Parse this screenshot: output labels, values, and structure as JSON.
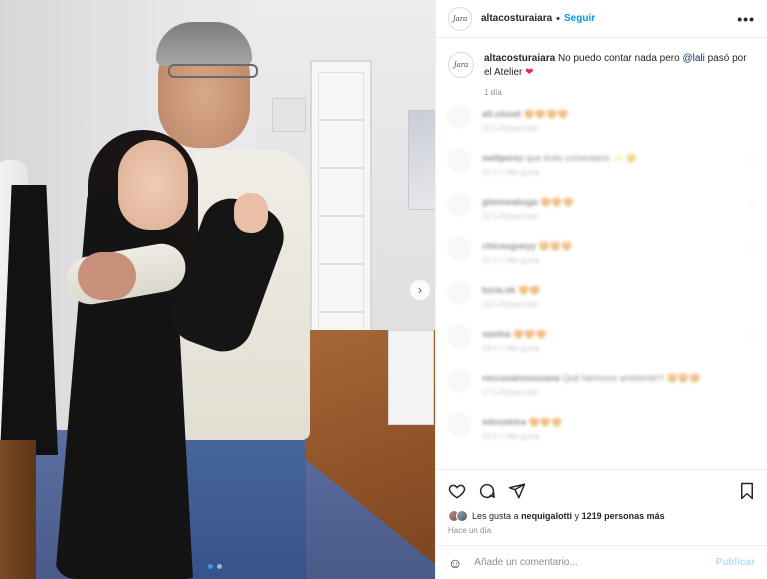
{
  "header": {
    "avatar_text": "Jara",
    "username": "altacosturaiara",
    "separator": "•",
    "follow_label": "Seguir",
    "more_label": "•••"
  },
  "caption": {
    "avatar_text": "Jara",
    "username": "altacosturaiara",
    "text_before": "No puedo contar nada pero",
    "mention": "@lali",
    "text_after": "pasó por el Atelier",
    "heart": "❤",
    "time": "1 día"
  },
  "comments": [
    {
      "user": "alt.closet",
      "text": "😍😍😍😍",
      "meta": "23 h  Responder"
    },
    {
      "user": "meliperez",
      "text": "que lindo comentario ✨ 😊",
      "meta": "21 h  1 Me gusta"
    },
    {
      "user": "gimmeabuga",
      "text": "😍😍😍",
      "meta": "22 h  Responder"
    },
    {
      "user": "chicasgueyy",
      "text": "🤩🤩🤩",
      "meta": "20 h  1 Me gusta"
    },
    {
      "user": "lucia.ok",
      "text": "😍😍",
      "meta": "19 h  Responder"
    },
    {
      "user": "vanina",
      "text": "😍😍😍",
      "meta": "18 h  1 Me gusta"
    },
    {
      "user": "roccasalvosusana",
      "text": "Qué hermoso ambiente!!! 🤩🤩😍",
      "meta": "17 h  Responder"
    },
    {
      "user": "mtrosteira",
      "text": "😍😍😍",
      "meta": "16 h  1 Me gusta"
    }
  ],
  "carousel": {
    "next_label": "›",
    "total_slides": 2,
    "active_slide": 1
  },
  "likes": {
    "prefix": "Les gusta a",
    "user": "nequigalotti",
    "middle": "y",
    "count": "1219 personas más",
    "time": "Hace un día"
  },
  "add_comment": {
    "emoji": "☺",
    "placeholder": "Añade un comentario...",
    "publish_label": "Publicar"
  },
  "colors": {
    "follow": "#0095f6",
    "publish_disabled": "#b2dffc",
    "heart": "#e0304a",
    "active_dot": "#3897f0"
  },
  "icons": [
    "heart-icon",
    "comment-icon",
    "share-icon",
    "bookmark-icon",
    "emoji-icon",
    "more-options-icon",
    "chevron-right-icon"
  ]
}
